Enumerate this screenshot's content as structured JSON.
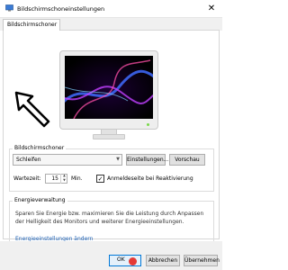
{
  "window": {
    "title": "Bildschirmschoneinstellungen",
    "close_glyph": "✕"
  },
  "tabs": [
    {
      "label": "Bildschirmschoner",
      "active": true
    }
  ],
  "screensaver": {
    "group_label": "Bildschirmschoner",
    "selected": "Schleifen",
    "settings_button": "Einstellungen...",
    "preview_button": "Vorschau",
    "wait_label": "Wartezeit:",
    "wait_value": "15",
    "wait_unit": "Min.",
    "resume_checked": true,
    "resume_label": "Anmeldeseite bei Reaktivierung"
  },
  "energy": {
    "group_label": "Energieverwaltung",
    "description": "Sparen Sie Energie bzw. maximieren Sie die Leistung durch Anpassen der Helligkeit des Monitors und weiterer Energieeinstellungen.",
    "link": "Energieeinstellungen ändern"
  },
  "buttons": {
    "ok": "OK",
    "cancel": "Abbrechen",
    "apply": "Übernehmen"
  },
  "icons": [
    "screensaver-window-icon",
    "close-icon",
    "dropdown-chevron-icon",
    "spin-arrows-icon",
    "checkmark-icon",
    "pointer-arrow-icon",
    "cursor-dot-icon"
  ],
  "colors": {
    "accent": "#0078d7",
    "link": "#1a5fb4",
    "cursor": "#e53935"
  }
}
